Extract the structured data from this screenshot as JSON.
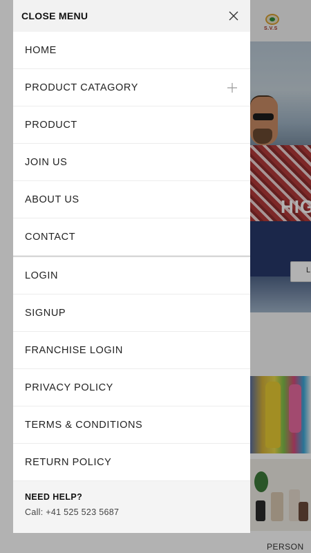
{
  "drawer": {
    "header_title": "CLOSE MENU",
    "close_icon": "close-icon",
    "primary_items": [
      {
        "label": "HOME",
        "expandable": false
      },
      {
        "label": "PRODUCT CATAGORY",
        "expandable": true,
        "expand_icon": "plus-icon"
      },
      {
        "label": "PRODUCT",
        "expandable": false
      },
      {
        "label": "JOIN US",
        "expandable": false
      },
      {
        "label": "ABOUT US",
        "expandable": false
      },
      {
        "label": "CONTACT",
        "expandable": false
      }
    ],
    "secondary_items": [
      {
        "label": "LOGIN"
      },
      {
        "label": "SIGNUP"
      },
      {
        "label": "FRANCHISE LOGIN"
      },
      {
        "label": "PRIVACY POLICY"
      },
      {
        "label": "TERMS & CONDITIONS"
      },
      {
        "label": "RETURN POLICY"
      }
    ],
    "help": {
      "title": "NEED HELP?",
      "contact": "Call: +41 525 523 5687"
    }
  },
  "background": {
    "logo_text": "S.V.S",
    "hero_text": "HIG",
    "hero_button_label": "L",
    "product_label": "PERSON"
  },
  "colors": {
    "drawer_bg": "#ffffff",
    "header_bg": "#f2f2f2",
    "overlay": "rgba(0,0,0,0.30)"
  }
}
